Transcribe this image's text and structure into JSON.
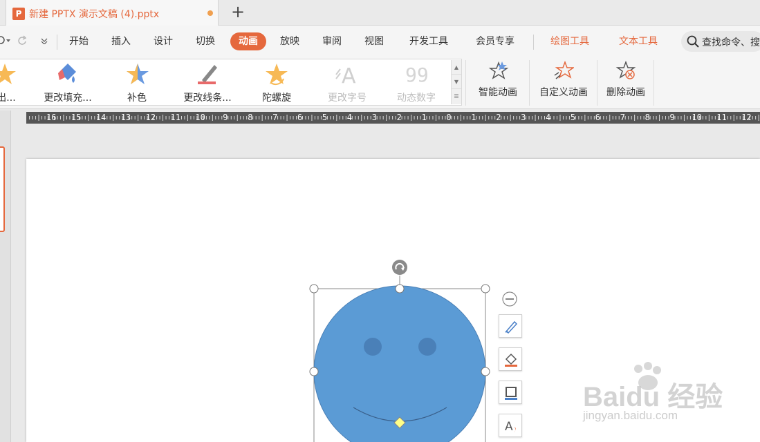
{
  "tab": {
    "app_icon_letter": "P",
    "title": "新建 PPTX 演示文稿 (4).pptx",
    "new_tab_symbol": "+"
  },
  "menu": {
    "items": [
      {
        "label": "开始"
      },
      {
        "label": "插入"
      },
      {
        "label": "设计"
      },
      {
        "label": "切换"
      },
      {
        "label": "动画"
      },
      {
        "label": "放映"
      },
      {
        "label": "审阅"
      },
      {
        "label": "视图"
      },
      {
        "label": "开发工具"
      },
      {
        "label": "会员专享"
      },
      {
        "label": "绘图工具"
      },
      {
        "label": "文本工具"
      }
    ],
    "active": "动画",
    "search_placeholder": "查找命令、搜"
  },
  "ribbon": {
    "gallery": [
      {
        "label": "突出..."
      },
      {
        "label": "更改填充..."
      },
      {
        "label": "补色"
      },
      {
        "label": "更改线条..."
      },
      {
        "label": "陀螺旋"
      },
      {
        "label": "更改字号"
      },
      {
        "label": "动态数字"
      }
    ],
    "buttons": [
      {
        "label": "智能动画"
      },
      {
        "label": "自定义动画"
      },
      {
        "label": "删除动画"
      }
    ]
  },
  "ruler": {
    "numbers": [
      "16",
      "15",
      "14",
      "13",
      "12",
      "11",
      "10",
      "9",
      "8",
      "7",
      "6",
      "5",
      "4",
      "3",
      "2",
      "1",
      "0",
      "1",
      "2",
      "3",
      "4",
      "5",
      "6",
      "7",
      "8",
      "9",
      "10",
      "11",
      "12"
    ]
  },
  "colors": {
    "accent": "#e5683d",
    "shape_fill": "#5b9bd5",
    "eye_fill": "#4a80b8"
  },
  "watermark": {
    "main": "Baidu 经验",
    "sub": "jingyan.baidu.com"
  }
}
